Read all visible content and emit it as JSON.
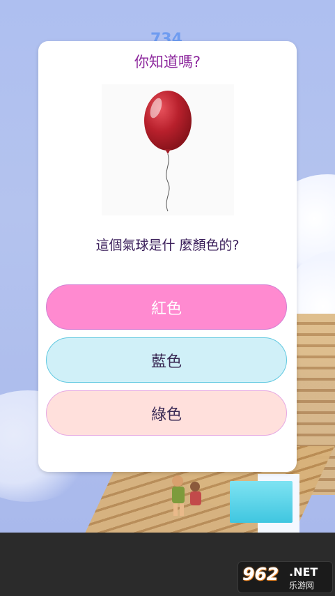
{
  "background": {
    "score_peek": "734"
  },
  "dialog": {
    "title": "你知道嗎?",
    "image_icon": "red-balloon-icon",
    "question": "這個氣球是什 麼顏色的?",
    "options": [
      {
        "label": "紅色",
        "color": "#ff8ad0"
      },
      {
        "label": "藍色",
        "color": "#d0f0f8"
      },
      {
        "label": "綠色",
        "color": "#ffe0dc"
      }
    ]
  },
  "watermark": {
    "number": "962",
    "suffix": ".NET",
    "cn": "乐游网"
  }
}
